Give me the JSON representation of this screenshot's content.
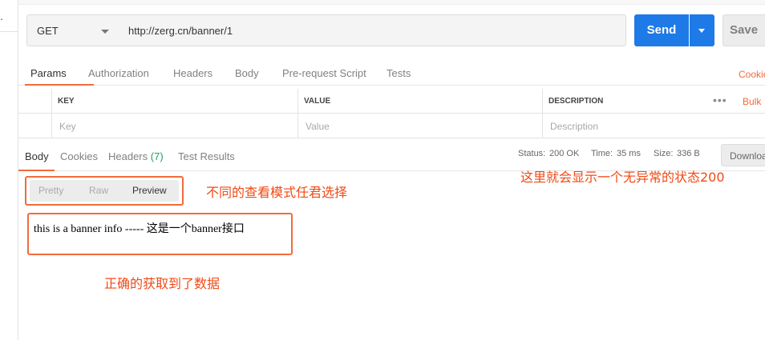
{
  "left_strip": {
    "glyph": "."
  },
  "request": {
    "method": "GET",
    "url": "http://zerg.cn/banner/1",
    "send_label": "Send",
    "save_label": "Save"
  },
  "request_tabs": [
    "Params",
    "Authorization",
    "Headers",
    "Body",
    "Pre-request Script",
    "Tests"
  ],
  "cookies_label": "Cookies",
  "params_table": {
    "headers": [
      "KEY",
      "VALUE",
      "DESCRIPTION"
    ],
    "placeholders": [
      "Key",
      "Value",
      "Description"
    ],
    "more_label": "•••",
    "bulk_label": "Bulk"
  },
  "response_tabs": {
    "body": "Body",
    "cookies": "Cookies",
    "headers": "Headers",
    "headers_count": "(7)",
    "test_results": "Test Results"
  },
  "status": {
    "status_label": "Status:",
    "status_value": "200 OK",
    "time_label": "Time:",
    "time_value": "35 ms",
    "size_label": "Size:",
    "size_value": "336 B",
    "download_label": "Download"
  },
  "view_modes": [
    "Pretty",
    "Raw",
    "Preview"
  ],
  "preview_body": "this is a banner info ----- 这是一个banner接口",
  "annotations": {
    "modes_note": "不同的查看模式任君选择",
    "status_note": "这里就会显示一个无异常的状态200",
    "data_note": "正确的获取到了数据"
  },
  "colors": {
    "accent": "#f26b3a",
    "send_blue": "#1e7ae6",
    "success_green": "#1aa260",
    "annotation_red": "#f04a16"
  }
}
